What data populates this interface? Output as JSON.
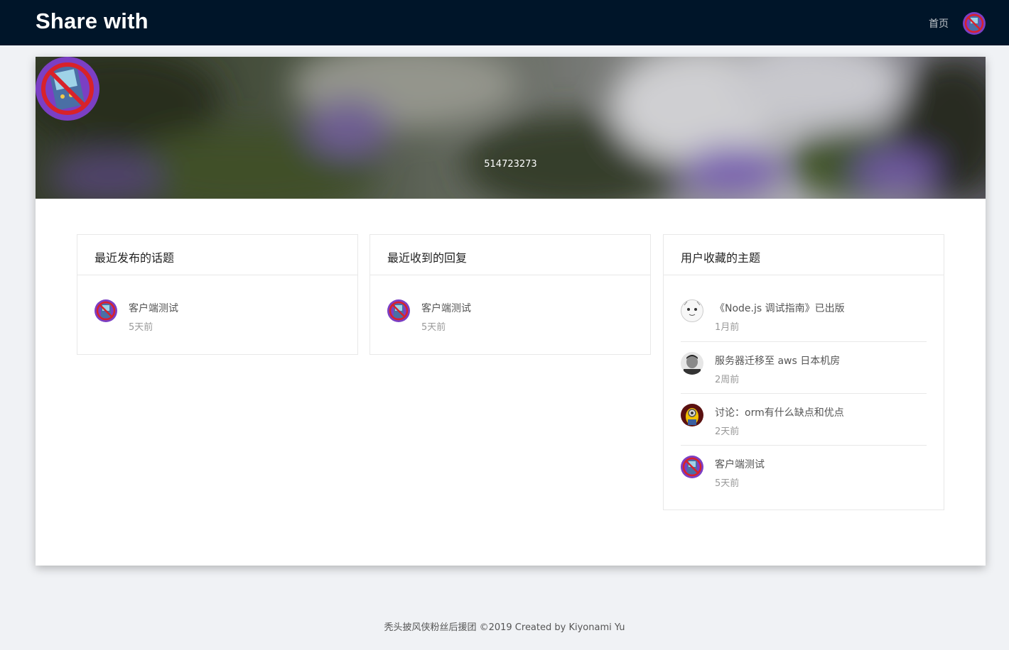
{
  "header": {
    "brand": "Share with",
    "nav_home": "首页"
  },
  "profile": {
    "username": "514723273"
  },
  "panels": [
    {
      "title": "最近发布的话题",
      "items": [
        {
          "title": "客户端测试",
          "time": "5天前",
          "avatar": "crossed-device-avatar"
        }
      ]
    },
    {
      "title": "最近收到的回复",
      "items": [
        {
          "title": "客户端测试",
          "time": "5天前",
          "avatar": "crossed-device-avatar"
        }
      ]
    },
    {
      "title": "用户收藏的主题",
      "items": [
        {
          "title": "《Node.js 调试指南》已出版",
          "time": "1月前",
          "avatar": "cartoon-face-avatar"
        },
        {
          "title": "服务器迁移至 aws 日本机房",
          "time": "2周前",
          "avatar": "portrait-avatar"
        },
        {
          "title": "讨论：orm有什么缺点和优点",
          "time": "2天前",
          "avatar": "minion-avatar"
        },
        {
          "title": "客户端测试",
          "time": "5天前",
          "avatar": "crossed-device-avatar"
        }
      ]
    }
  ],
  "footer": {
    "text": "秃头披风侠粉丝后援团 ©2019 Created by Kiyonami Yu"
  },
  "colors": {
    "topbar": "#001529",
    "page_bg": "#f0f2f5",
    "avatar_purple": "#7b3fc4",
    "avatar_cross": "#d8222a"
  }
}
